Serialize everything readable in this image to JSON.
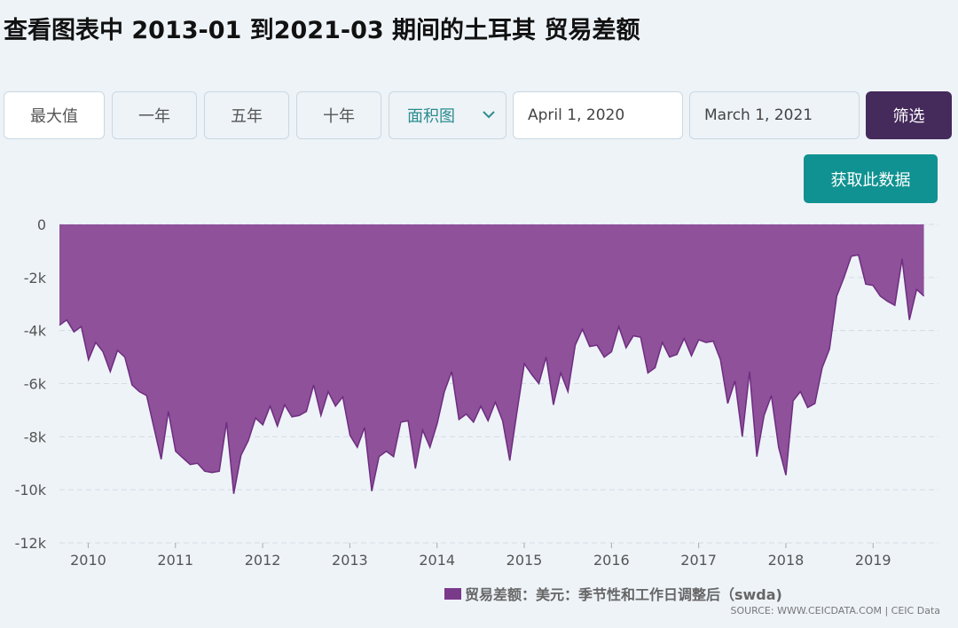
{
  "title": "查看图表中 2013-01 到2021-03 期间的土耳其 贸易差额",
  "range_buttons": [
    {
      "label": "最大值",
      "active": true
    },
    {
      "label": "一年",
      "active": false
    },
    {
      "label": "五年",
      "active": false
    },
    {
      "label": "十年",
      "active": false
    }
  ],
  "chart_type_select": {
    "value": "面积图"
  },
  "date_from": "April 1, 2020",
  "date_to": "March 1, 2021",
  "filter_label": "筛选",
  "get_data_label": "获取此数据",
  "legend_label": "贸易差额：美元：季节性和工作日调整后（swda)",
  "source_text": "SOURCE: WWW.CEICDATA.COM | CEIC Data",
  "colors": {
    "area": "#8e519a",
    "line": "#6e2d80",
    "filter": "#452a5c",
    "get_data": "#0f9291"
  },
  "chart_data": {
    "type": "area",
    "x_start": 2009.67,
    "x_step": 0.0833,
    "xlim": [
      2009.67,
      2019.75
    ],
    "ylim": [
      -12000,
      0
    ],
    "yticks": [
      0,
      -2000,
      -4000,
      -6000,
      -8000,
      -10000,
      -12000
    ],
    "ytick_labels": [
      "0",
      "-2k",
      "-4k",
      "-6k",
      "-8k",
      "-10k",
      "-12k"
    ],
    "xticks": [
      2010,
      2011,
      2012,
      2013,
      2014,
      2015,
      2016,
      2017,
      2018,
      2019
    ],
    "xtick_labels": [
      "2010",
      "2011",
      "2012",
      "2013",
      "2014",
      "2015",
      "2016",
      "2017",
      "2018",
      "2019"
    ],
    "grid": true,
    "values": [
      -3800,
      -3600,
      -4050,
      -3850,
      -5100,
      -4450,
      -4800,
      -5550,
      -4750,
      -5000,
      -6050,
      -6300,
      -6450,
      -7650,
      -8850,
      -7050,
      -8550,
      -8800,
      -9050,
      -9000,
      -9300,
      -9350,
      -9300,
      -7450,
      -10150,
      -8700,
      -8150,
      -7300,
      -7550,
      -6850,
      -7600,
      -6800,
      -7250,
      -7200,
      -7050,
      -6050,
      -7200,
      -6300,
      -6850,
      -6500,
      -7950,
      -8400,
      -7650,
      -10050,
      -8750,
      -8550,
      -8750,
      -7450,
      -7400,
      -9200,
      -7750,
      -8400,
      -7500,
      -6300,
      -5550,
      -7350,
      -7150,
      -7450,
      -6850,
      -7400,
      -6700,
      -7400,
      -8900,
      -7050,
      -5250,
      -5650,
      -6000,
      -5000,
      -6800,
      -5600,
      -6300,
      -4550,
      -3950,
      -4600,
      -4550,
      -5000,
      -4800,
      -3850,
      -4650,
      -4200,
      -4250,
      -5600,
      -5400,
      -4450,
      -5000,
      -4900,
      -4300,
      -4950,
      -4350,
      -4450,
      -4400,
      -5100,
      -6750,
      -5900,
      -8000,
      -5550,
      -8750,
      -7200,
      -6450,
      -8400,
      -9450,
      -6650,
      -6300,
      -6900,
      -6750,
      -5400,
      -4700,
      -2700,
      -2000,
      -1200,
      -1150,
      -2250,
      -2300,
      -2700,
      -2900,
      -3050,
      -1300,
      -3600,
      -2450,
      -2700
    ]
  }
}
